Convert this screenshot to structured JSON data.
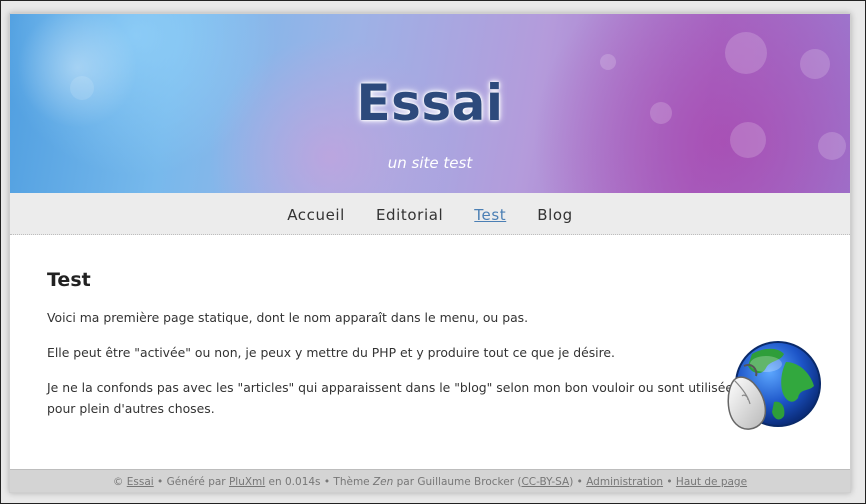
{
  "site": {
    "title": "Essai",
    "subtitle": "un site test"
  },
  "nav": {
    "items": [
      {
        "label": "Accueil",
        "active": false
      },
      {
        "label": "Editorial",
        "active": false
      },
      {
        "label": "Test",
        "active": true
      },
      {
        "label": "Blog",
        "active": false
      }
    ]
  },
  "article": {
    "heading": "Test",
    "paragraphs": [
      "Voici ma première page statique, dont le nom apparaît dans le menu, ou pas.",
      "Elle peut être \"activée\" ou non, je peux y mettre du PHP et y produire tout ce que je désire.",
      "Je ne la confonds pas avec les \"articles\" qui apparaissent dans le \"blog\" selon mon bon vouloir ou sont utilisées pour plein d'autres choses."
    ]
  },
  "overlay": {
    "icon": "globe-mouse-icon"
  },
  "footer": {
    "copyright": "©",
    "site_link": "Essai",
    "sep1": "•",
    "generated_by": "Généré par",
    "engine_link": "PluXml",
    "timing": "en 0.014s",
    "sep2": "•",
    "theme_prefix": "Thème",
    "theme_name": "Zen",
    "theme_author": "par Guillaume Brocker (",
    "license_link": "CC-BY-SA",
    "theme_close": ")",
    "sep3": "•",
    "admin_link": "Administration",
    "sep4": "•",
    "top_link": "Haut de page"
  },
  "colors": {
    "title": "#2d4a7c",
    "nav_active": "#4b7fb4",
    "nav_bg": "#ececec",
    "footer_bg": "#d4d4d4"
  }
}
